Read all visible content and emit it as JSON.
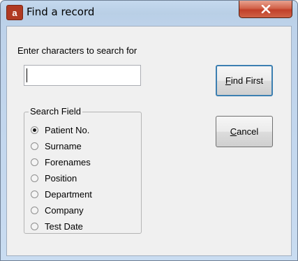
{
  "window": {
    "title": "Find a record",
    "app_icon_letter": "a",
    "close_glyph": "X"
  },
  "search": {
    "prompt": "Enter characters to search for",
    "value": "",
    "placeholder": ""
  },
  "buttons": {
    "find_first": "Find First",
    "cancel": "Cancel"
  },
  "search_field": {
    "legend": "Search Field",
    "options": [
      {
        "label": "Patient No.",
        "checked": true
      },
      {
        "label": "Surname",
        "checked": false
      },
      {
        "label": "Forenames",
        "checked": false
      },
      {
        "label": "Position",
        "checked": false
      },
      {
        "label": "Department",
        "checked": false
      },
      {
        "label": "Company",
        "checked": false
      },
      {
        "label": "Test Date",
        "checked": false
      }
    ]
  },
  "colors": {
    "close_button": "#c7432d",
    "default_button_border": "#3c7fb1",
    "client_background": "#f0f0f0"
  },
  "icons": {
    "app": "app-logo-icon",
    "close": "close-icon"
  }
}
